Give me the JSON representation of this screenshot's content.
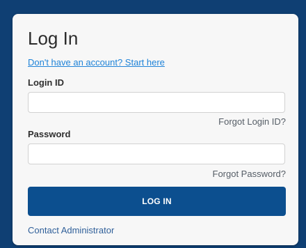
{
  "login": {
    "title": "Log In",
    "signup_link": "Don't have an account? Start here",
    "login_id_label": "Login ID",
    "login_id_value": "",
    "forgot_login_id": "Forgot Login ID?",
    "password_label": "Password",
    "password_value": "",
    "forgot_password": "Forgot Password?",
    "submit_label": "LOG IN",
    "contact_link": "Contact Administrator"
  },
  "colors": {
    "background": "#0f3f73",
    "card": "#f7f7f7",
    "primary_button": "#0c4f8f",
    "link": "#1f83d8"
  }
}
